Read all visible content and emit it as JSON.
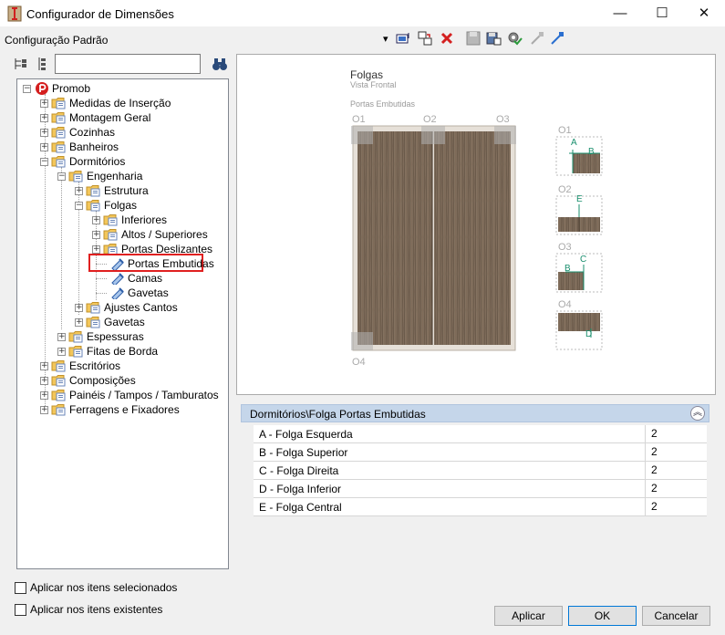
{
  "window": {
    "title": "Configurador de Dimensões",
    "minimize": "—",
    "maximize": "☐",
    "close": "✕"
  },
  "config": {
    "label": "Configuração Padrão",
    "dropdown_arrow": "▾"
  },
  "tree": {
    "root": "Promob",
    "items": [
      "Medidas de Inserção",
      "Montagem Geral",
      "Cozinhas",
      "Banheiros",
      "Dormitórios",
      "Engenharia",
      "Estrutura",
      "Folgas",
      "Inferiores",
      "Altos / Superiores",
      "Portas Deslizantes",
      "Portas Embutidas",
      "Camas",
      "Gavetas",
      "Ajustes Cantos",
      "Gavetas",
      "Espessuras",
      "Fitas de Borda",
      "Escritórios",
      "Composições",
      "Painéis / Tampos / Tamburatos",
      "Ferragens e Fixadores"
    ]
  },
  "preview": {
    "title": "Folgas",
    "subtitle": "Vista Frontal",
    "section": "Portas Embutidas",
    "markers": [
      "O1",
      "O2",
      "O3",
      "O4"
    ],
    "letters": [
      "A",
      "B",
      "E",
      "B",
      "C",
      "D"
    ]
  },
  "properties": {
    "header": "Dormitórios\\Folga Portas Embutidas",
    "rows": [
      {
        "label": "A - Folga Esquerda",
        "value": "2"
      },
      {
        "label": "B - Folga Superior",
        "value": "2"
      },
      {
        "label": "C - Folga Direita",
        "value": "2"
      },
      {
        "label": "D - Folga Inferior",
        "value": "2"
      },
      {
        "label": "E - Folga Central",
        "value": "2"
      }
    ]
  },
  "options": {
    "apply_selected": "Aplicar nos itens selecionados",
    "apply_existing": "Aplicar nos itens existentes"
  },
  "buttons": {
    "apply": "Aplicar",
    "ok": "OK",
    "cancel": "Cancelar"
  },
  "colors": {
    "selection_border": "#e02020",
    "header_bg": "#c5d6ea",
    "wood": "#7d6b58",
    "accent_line": "#1a8f6e"
  }
}
